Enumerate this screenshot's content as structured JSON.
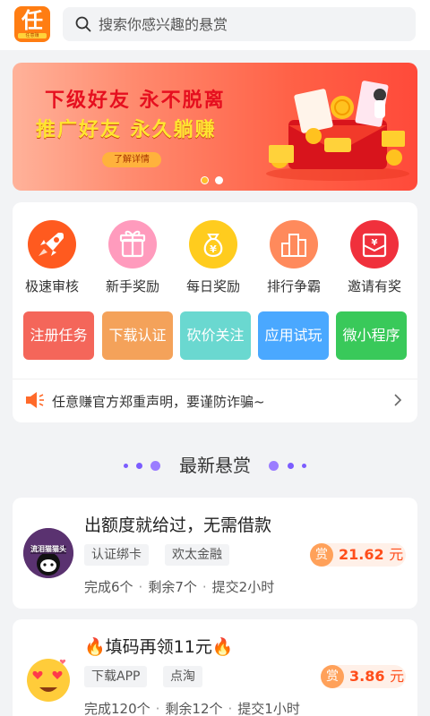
{
  "header": {
    "logo_char": "任",
    "logo_sub": "任意赚",
    "search_placeholder": "搜索你感兴趣的悬赏"
  },
  "banner": {
    "line1": "下级好友 永不脱离",
    "line2": "推广好友 永久躺赚",
    "detail_label": "了解详情",
    "page_indicator": {
      "count": 2,
      "active": 1
    }
  },
  "quick_entries": [
    {
      "label": "极速审核",
      "icon": "rocket-icon",
      "color": "#ff5a1f"
    },
    {
      "label": "新手奖励",
      "icon": "gift-icon",
      "color": "#ff9bbd"
    },
    {
      "label": "每日奖励",
      "icon": "money-bag-icon",
      "color": "#ffcc1e"
    },
    {
      "label": "排行争霸",
      "icon": "ranking-icon",
      "color": "#ff8a5c"
    },
    {
      "label": "邀请有奖",
      "icon": "envelope-icon",
      "color": "#f0303c"
    }
  ],
  "task_tiles": [
    {
      "label": "注册任务",
      "color": "#f4665a"
    },
    {
      "label": "下载认证",
      "color": "#f4a25a"
    },
    {
      "label": "砍价关注",
      "color": "#6ad8d0"
    },
    {
      "label": "应用试玩",
      "color": "#4aa8ff"
    },
    {
      "label": "微小程序",
      "color": "#39c95a"
    }
  ],
  "notice": {
    "text": "任意赚官方郑重声明，要谨防诈骗~"
  },
  "section": {
    "title": "最新悬赏"
  },
  "tasks": [
    {
      "title": "出额度就给过，无需借款",
      "avatar": "avatar-cat-icon",
      "avatar_text": "流泪猫猫头",
      "tags": [
        "认证绑卡",
        "欢太金融"
      ],
      "reward_badge": "赏",
      "reward_amount": "21.62",
      "reward_unit": "元",
      "completed": "完成6个",
      "remaining": "剩余7个",
      "submit": "提交2小时"
    },
    {
      "title": "🔥填码再领11元🔥",
      "avatar": "heart-eyes-emoji-icon",
      "tags": [
        "下载APP",
        "点淘"
      ],
      "reward_badge": "赏",
      "reward_amount": "3.86",
      "reward_unit": "元",
      "completed": "完成120个",
      "remaining": "剩余12个",
      "submit": "提交1小时"
    }
  ],
  "colors": {
    "accent": "#ff7d12",
    "reward": "#ff4d1a",
    "section_dots": "#7b5cff"
  }
}
